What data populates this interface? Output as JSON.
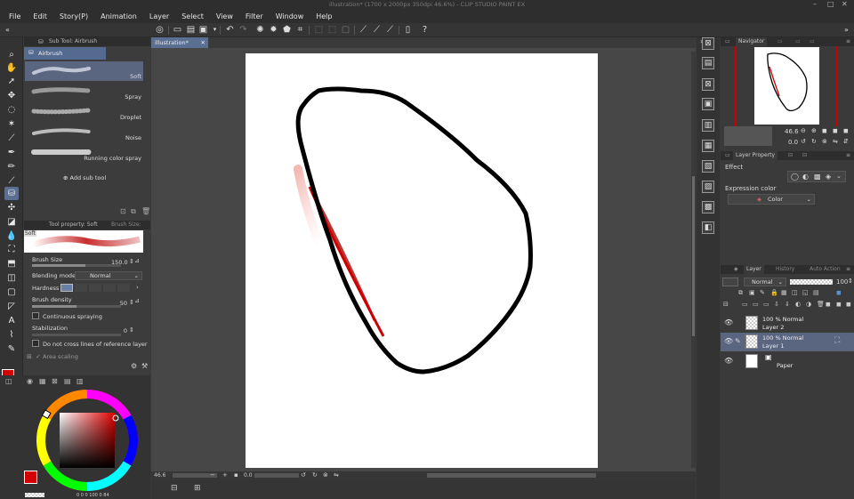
{
  "titlebar": {
    "title": "illustration* (1700 x 2000px 350dpi 46.6%) - CLIP STUDIO PAINT EX"
  },
  "menu": [
    "File",
    "Edit",
    "Story(P)",
    "Animation",
    "Layer",
    "Select",
    "View",
    "Filter",
    "Window",
    "Help"
  ],
  "subtool": {
    "header": "Sub Tool: Airbrush",
    "tab": "Airbrush",
    "brushes": [
      "Soft",
      "Spray",
      "Droplet",
      "Noise",
      "Running color spray"
    ],
    "add_label": "Add sub tool"
  },
  "toolprop": {
    "header": "Tool property: Soft",
    "header2": "Brush Size: Soft",
    "preview_label": "Soft",
    "brush_size_label": "Brush Size",
    "brush_size_value": "150.0",
    "blending_label": "Blending mode",
    "blending_value": "Normal",
    "hardness_label": "Hardness",
    "density_label": "Brush density",
    "density_value": "50",
    "continuous_label": "Continuous spraying",
    "stabilization_label": "Stabilization",
    "stabilization_value": "0",
    "crosslines_label": "Do not cross lines of reference layer",
    "area_scaling_label": "Area scaling"
  },
  "color": {
    "main": "#d40000",
    "sub": "#ffffff",
    "wheel_readout": "0  0  0  100  0  84"
  },
  "canvas": {
    "doc_tab": "illustration*",
    "zoom": "46.6",
    "angle": "0.0"
  },
  "navigator": {
    "header": "Navigator",
    "zoom": "46.6",
    "angle": "0.0"
  },
  "layerprop": {
    "header": "Layer Property",
    "effect_label": "Effect",
    "expression_label": "Expression color",
    "expression_value": "Color"
  },
  "layers": {
    "tabs": [
      "Layer",
      "History",
      "Auto Action"
    ],
    "blend_mode": "Normal",
    "opacity": "100",
    "items": [
      {
        "line1": "100 % Normal",
        "line2": "Layer 2"
      },
      {
        "line1": "100 % Normal",
        "line2": "Layer 1"
      },
      {
        "line1": "",
        "line2": "Paper"
      }
    ]
  },
  "colors": {
    "accent": "#5b6f93",
    "stroke_black": "#000000",
    "stroke_red": "#b00000"
  }
}
